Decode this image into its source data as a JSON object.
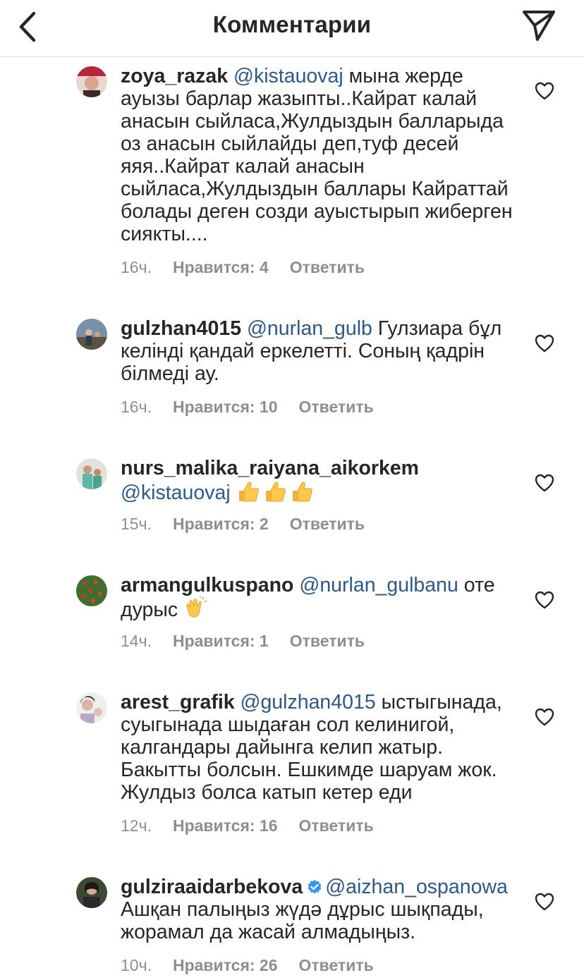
{
  "header": {
    "title": "Комментарии"
  },
  "comments": [
    {
      "username": "zoya_razak",
      "mention": "@kistauovaj",
      "text": " мына жерде ауызы барлар жазыпты..Кайрат калай анасын сыйласа,Жулдыздын балларыда оз анасын сыйлайды деп,туф  десей яяя..Кайрат калай анасын сыйласа,Жулдыздын баллары Кайраттай болады деген созди ауыстырып жиберген сиякты....",
      "time": "16ч.",
      "likes": "Нравится: 4",
      "reply": "Ответить"
    },
    {
      "username": "gulzhan4015",
      "mention": "@nurlan_gulb",
      "text": " Гулзиара бұл келінді қандай еркелетті. Соның қадрін білмеді ау.",
      "time": "16ч.",
      "likes": "Нравится: 10",
      "reply": "Ответить"
    },
    {
      "username": "nurs_malika_raiyana_aikorkem",
      "mention": "@kistauovaj",
      "text": "",
      "time": "15ч.",
      "likes": "Нравится: 2",
      "reply": "Ответить"
    },
    {
      "username": "armangulkuspano",
      "mention": "@nurlan_gulbanu",
      "text": " оте дурыс ",
      "time": "14ч.",
      "likes": "Нравится: 1",
      "reply": "Ответить"
    },
    {
      "username": "arest_grafik",
      "mention": "@gulzhan4015",
      "text": " ыстыгынада, суыгынада шыдаған сол келинигой, калгандары дайынга келип жатыр. Бакытты болсын. Ешкимде шаруам жок. Жулдыз болса катып кетер еди",
      "time": "12ч.",
      "likes": "Нравится: 16",
      "reply": "Ответить"
    },
    {
      "username": "gulziraaidarbekova",
      "mention": "@aizhan_ospanowa",
      "text": "Ашқан палыңыз жүдә дұрыс шықпады, жорамал да жасай алмадыңыз.",
      "time": "10ч.",
      "likes": "Нравится: 26",
      "reply": "Ответить"
    }
  ],
  "icons": {
    "back": "chevron-left-icon",
    "share": "paper-plane-icon",
    "like": "heart-outline-icon",
    "verified": "verified-badge-icon",
    "thumbs": "thumbs-up-emoji",
    "clap": "clapping-hands-emoji"
  },
  "colors": {
    "text": "#262626",
    "secondary": "#8e8e8e",
    "mention": "#2b5a8a",
    "verified": "#3897f0",
    "divider": "#dbdbdb"
  }
}
